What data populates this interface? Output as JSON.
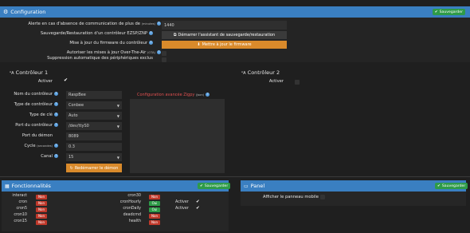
{
  "config": {
    "title": "Configuration",
    "save_label": "Sauvegarder",
    "rows": {
      "alert_label": "Alerte en cas d'absence de communication de plus de",
      "alert_unit": "(minutes)",
      "alert_value": "1440",
      "backup_label": "Sauvegarde/Restauration d'un contrôleur EZSP/ZNP",
      "backup_button": "Démarrer l'assistant de sauvegarde/restauration",
      "firmware_label": "Mise à jour du firmware du contrôleur",
      "firmware_button": "Mettre à jour le firmware",
      "ota_label": "Autoriser les mises à jour Over-The-Air",
      "ota_unit": "(OTA)",
      "autodelete_label": "Suppression automatique des périphériques exclus"
    }
  },
  "controller1": {
    "title": "Contrôleur 1",
    "activate_label": "Activer",
    "name_label": "Nom du contrôleur",
    "name_value": "RaspBee",
    "type_label": "Type de contrôleur",
    "type_value": "Conbee",
    "key_label": "Type de clé",
    "key_value": "Auto",
    "port_label": "Port du contrôleur",
    "port_value": "/dev/ttyS0",
    "daemon_port_label": "Port du démon",
    "daemon_port_value": "8089",
    "cycle_label": "Cycle",
    "cycle_unit": "(secondes)",
    "cycle_value": "0.3",
    "channel_label": "Canal",
    "channel_value": "15",
    "restart_button": "Redémarrer le démon",
    "advanced_label": "Configuration avancée Zigpy",
    "advanced_unit": "(Json)"
  },
  "controller2": {
    "title": "Contrôleur 2",
    "activate_label": "Activer"
  },
  "features": {
    "title": "Fonctionnalités",
    "save_label": "Sauvegarder",
    "left": [
      {
        "name": "interact",
        "state": "Non"
      },
      {
        "name": "cron",
        "state": "Non"
      },
      {
        "name": "cron5",
        "state": "Non"
      },
      {
        "name": "cron10",
        "state": "Non"
      },
      {
        "name": "cron15",
        "state": "Non"
      }
    ],
    "right": [
      {
        "name": "cron30",
        "state": "Non"
      },
      {
        "name": "cronHourly",
        "state": "Oui",
        "activate": "Activer"
      },
      {
        "name": "cronDaily",
        "state": "Oui",
        "activate": "Activer"
      },
      {
        "name": "deadcmd",
        "state": "Non"
      },
      {
        "name": "health",
        "state": "Non"
      }
    ]
  },
  "panel": {
    "title": "Panel",
    "save_label": "Sauvegarder",
    "mobile_label": "Afficher le panneau mobile"
  },
  "colors": {
    "header_blue": "#3a7fc1",
    "save_green": "#2e9b48",
    "action_orange": "#d98a2b",
    "tag_red": "#c0392b",
    "advanced_red": "#e05050"
  }
}
